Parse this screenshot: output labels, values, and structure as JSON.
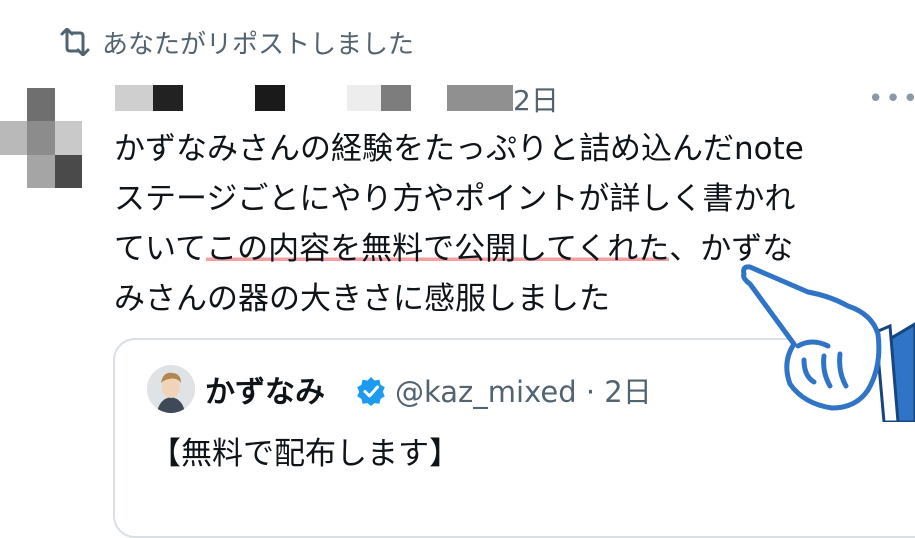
{
  "repost": {
    "label": "あなたがリポストしました",
    "icon": "repost-icon"
  },
  "tweet": {
    "time": "2日",
    "more_icon": "more-icon",
    "lines": [
      {
        "before": "かずなみさんの経験をたっぷりと詰め込んだnote",
        "highlight": "",
        "after": ""
      },
      {
        "before": "ステージごとにやり方やポイントが詳しく書かれ",
        "highlight": "",
        "after": ""
      },
      {
        "before": "ていて",
        "highlight": "この内容を無料で公開してくれた",
        "after": "、かずな"
      },
      {
        "before": "みさんの器の大きさに感服しました",
        "highlight": "",
        "after": ""
      }
    ]
  },
  "quote": {
    "name": "かずなみ",
    "verified_icon": "verified-badge-icon",
    "handle_time": "@kaz_mixed · 2日",
    "text": "【無料で配布します】"
  },
  "colors": {
    "text": "#0f1419",
    "secondary": "#536471",
    "highlight": "#f3a0a3",
    "verified": "#1d9bf0",
    "pointer_blue": "#2f74c6"
  }
}
